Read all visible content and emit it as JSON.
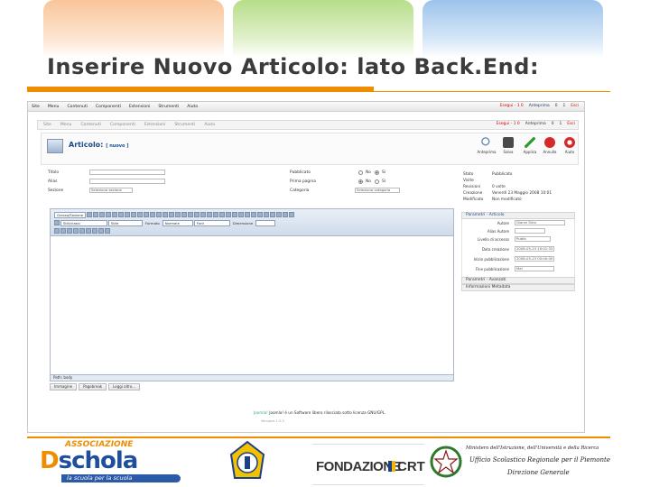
{
  "slide": {
    "title": "Inserire Nuovo Articolo: lato Back.End:"
  },
  "joomla": {
    "menubar": [
      "Site",
      "Menu",
      "Contenuti",
      "Componenti",
      "Estensioni",
      "Strumenti",
      "Aiuto"
    ],
    "status_top": {
      "messages": "Esegui - 1 0",
      "admin": "Anteprima",
      "count1": "0",
      "count2": "1",
      "logout": "Esci"
    },
    "submenu": [
      "Site",
      "Menu",
      "Contenuti",
      "Componenti",
      "Estensioni",
      "Strumenti",
      "Aiuto"
    ],
    "status_second": {
      "messages": "Esegui - 1 0",
      "admin": "Anteprima",
      "count1": "0",
      "count2": "1",
      "logout": "Esci"
    },
    "page_title": "Articolo:",
    "page_title_sub": "[ nuovo ]",
    "toolbar": [
      "Anteprima",
      "Salva",
      "Applica",
      "Annulla",
      "Aiuto"
    ],
    "form": {
      "title_label": "Titolo",
      "alias_label": "Alias",
      "section_label": "Sezione",
      "section_value": "Seleziona sezione",
      "published_label": "Pubblicato",
      "frontpage_label": "Prima pagina",
      "category_label": "Categoria",
      "category_value": "Seleziona categoria",
      "no": "No",
      "yes": "Sì"
    },
    "info": {
      "state_label": "Stato",
      "state_value": "Pubblicato",
      "hits_label": "Visite",
      "hits_value": "",
      "revised_label": "Revisioni",
      "revised_value": "0 volte",
      "created_label": "Creazione",
      "created_value": "Venerdì 23 Maggio 2008 10:01",
      "modified_label": "Modificato",
      "modified_value": "Non modificato"
    },
    "editor": {
      "style_select": "Stile",
      "format_label": "Formato",
      "format_value": "Normale",
      "font_select": "Font",
      "size_label": "Dimensione",
      "styles_select": "Stili/classi",
      "cut_label": "Grosso/Sezione",
      "path": "Path: body"
    },
    "editor_buttons": [
      "Immagine",
      "Pagebreak",
      "Leggi altro..."
    ],
    "params": {
      "articolo_header": "Parametri - Articolo",
      "author_label": "Autore",
      "author_value": "Gianni Sirio",
      "alias_author_label": "Alias Autore",
      "access_label": "Livello di accesso",
      "access_value": "Public",
      "created_date_label": "Data creazione",
      "created_date_value": "2008-05-23 10:01:33",
      "publish_start_label": "Inizio pubblicazione",
      "publish_start_value": "2008-05-23 00:00:00",
      "publish_end_label": "Fine pubblicazione",
      "publish_end_value": "Mai",
      "advanced_header": "Parametri - Avanzati",
      "metadata_header": "Informazioni Metadata"
    },
    "footer_note": "Joomla! è un Software libero rilasciato sotto licenza GNU/GPL.",
    "footer_highlight": "Joomla!",
    "footer_version": "Versione 1.5.3"
  },
  "logos": {
    "ds_assoc": "ASSOCIAZIONE",
    "ds_d": "D",
    "ds_schola": "schola",
    "ds_tag": "la scuola per la scuola",
    "fondazione": "FONDAZIONE",
    "crt": "CRT",
    "ministry_line1": "Ministero dell'Istruzione, dell'Università e della Ricerca",
    "ministry_line2": "Ufficio Scolastico Regionale per il Piemonte",
    "ministry_line3": "Direzione Generale"
  },
  "colors": {
    "accent_orange": "#f08c00",
    "joomla_blue": "#1a4b8c",
    "ds_blue": "#1f4e9e"
  }
}
